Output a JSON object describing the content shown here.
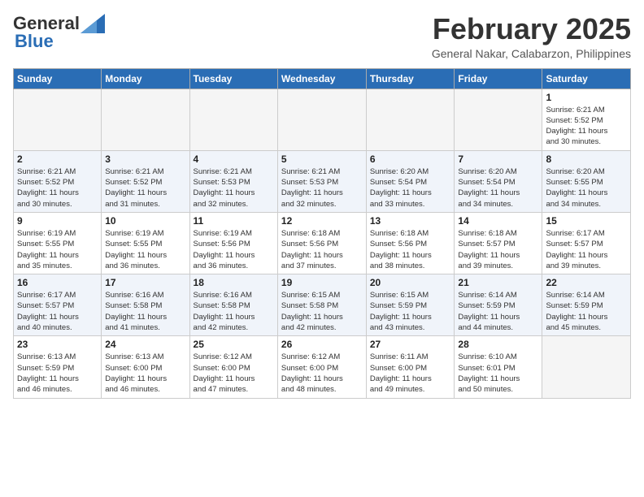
{
  "header": {
    "logo_general": "General",
    "logo_blue": "Blue",
    "month_title": "February 2025",
    "location": "General Nakar, Calabarzon, Philippines"
  },
  "days_of_week": [
    "Sunday",
    "Monday",
    "Tuesday",
    "Wednesday",
    "Thursday",
    "Friday",
    "Saturday"
  ],
  "weeks": [
    {
      "stripe": false,
      "days": [
        {
          "num": "",
          "info": ""
        },
        {
          "num": "",
          "info": ""
        },
        {
          "num": "",
          "info": ""
        },
        {
          "num": "",
          "info": ""
        },
        {
          "num": "",
          "info": ""
        },
        {
          "num": "",
          "info": ""
        },
        {
          "num": "1",
          "info": "Sunrise: 6:21 AM\nSunset: 5:52 PM\nDaylight: 11 hours\nand 30 minutes."
        }
      ]
    },
    {
      "stripe": true,
      "days": [
        {
          "num": "2",
          "info": "Sunrise: 6:21 AM\nSunset: 5:52 PM\nDaylight: 11 hours\nand 30 minutes."
        },
        {
          "num": "3",
          "info": "Sunrise: 6:21 AM\nSunset: 5:52 PM\nDaylight: 11 hours\nand 31 minutes."
        },
        {
          "num": "4",
          "info": "Sunrise: 6:21 AM\nSunset: 5:53 PM\nDaylight: 11 hours\nand 32 minutes."
        },
        {
          "num": "5",
          "info": "Sunrise: 6:21 AM\nSunset: 5:53 PM\nDaylight: 11 hours\nand 32 minutes."
        },
        {
          "num": "6",
          "info": "Sunrise: 6:20 AM\nSunset: 5:54 PM\nDaylight: 11 hours\nand 33 minutes."
        },
        {
          "num": "7",
          "info": "Sunrise: 6:20 AM\nSunset: 5:54 PM\nDaylight: 11 hours\nand 34 minutes."
        },
        {
          "num": "8",
          "info": "Sunrise: 6:20 AM\nSunset: 5:55 PM\nDaylight: 11 hours\nand 34 minutes."
        }
      ]
    },
    {
      "stripe": false,
      "days": [
        {
          "num": "9",
          "info": "Sunrise: 6:19 AM\nSunset: 5:55 PM\nDaylight: 11 hours\nand 35 minutes."
        },
        {
          "num": "10",
          "info": "Sunrise: 6:19 AM\nSunset: 5:55 PM\nDaylight: 11 hours\nand 36 minutes."
        },
        {
          "num": "11",
          "info": "Sunrise: 6:19 AM\nSunset: 5:56 PM\nDaylight: 11 hours\nand 36 minutes."
        },
        {
          "num": "12",
          "info": "Sunrise: 6:18 AM\nSunset: 5:56 PM\nDaylight: 11 hours\nand 37 minutes."
        },
        {
          "num": "13",
          "info": "Sunrise: 6:18 AM\nSunset: 5:56 PM\nDaylight: 11 hours\nand 38 minutes."
        },
        {
          "num": "14",
          "info": "Sunrise: 6:18 AM\nSunset: 5:57 PM\nDaylight: 11 hours\nand 39 minutes."
        },
        {
          "num": "15",
          "info": "Sunrise: 6:17 AM\nSunset: 5:57 PM\nDaylight: 11 hours\nand 39 minutes."
        }
      ]
    },
    {
      "stripe": true,
      "days": [
        {
          "num": "16",
          "info": "Sunrise: 6:17 AM\nSunset: 5:57 PM\nDaylight: 11 hours\nand 40 minutes."
        },
        {
          "num": "17",
          "info": "Sunrise: 6:16 AM\nSunset: 5:58 PM\nDaylight: 11 hours\nand 41 minutes."
        },
        {
          "num": "18",
          "info": "Sunrise: 6:16 AM\nSunset: 5:58 PM\nDaylight: 11 hours\nand 42 minutes."
        },
        {
          "num": "19",
          "info": "Sunrise: 6:15 AM\nSunset: 5:58 PM\nDaylight: 11 hours\nand 42 minutes."
        },
        {
          "num": "20",
          "info": "Sunrise: 6:15 AM\nSunset: 5:59 PM\nDaylight: 11 hours\nand 43 minutes."
        },
        {
          "num": "21",
          "info": "Sunrise: 6:14 AM\nSunset: 5:59 PM\nDaylight: 11 hours\nand 44 minutes."
        },
        {
          "num": "22",
          "info": "Sunrise: 6:14 AM\nSunset: 5:59 PM\nDaylight: 11 hours\nand 45 minutes."
        }
      ]
    },
    {
      "stripe": false,
      "days": [
        {
          "num": "23",
          "info": "Sunrise: 6:13 AM\nSunset: 5:59 PM\nDaylight: 11 hours\nand 46 minutes."
        },
        {
          "num": "24",
          "info": "Sunrise: 6:13 AM\nSunset: 6:00 PM\nDaylight: 11 hours\nand 46 minutes."
        },
        {
          "num": "25",
          "info": "Sunrise: 6:12 AM\nSunset: 6:00 PM\nDaylight: 11 hours\nand 47 minutes."
        },
        {
          "num": "26",
          "info": "Sunrise: 6:12 AM\nSunset: 6:00 PM\nDaylight: 11 hours\nand 48 minutes."
        },
        {
          "num": "27",
          "info": "Sunrise: 6:11 AM\nSunset: 6:00 PM\nDaylight: 11 hours\nand 49 minutes."
        },
        {
          "num": "28",
          "info": "Sunrise: 6:10 AM\nSunset: 6:01 PM\nDaylight: 11 hours\nand 50 minutes."
        },
        {
          "num": "",
          "info": ""
        }
      ]
    }
  ]
}
